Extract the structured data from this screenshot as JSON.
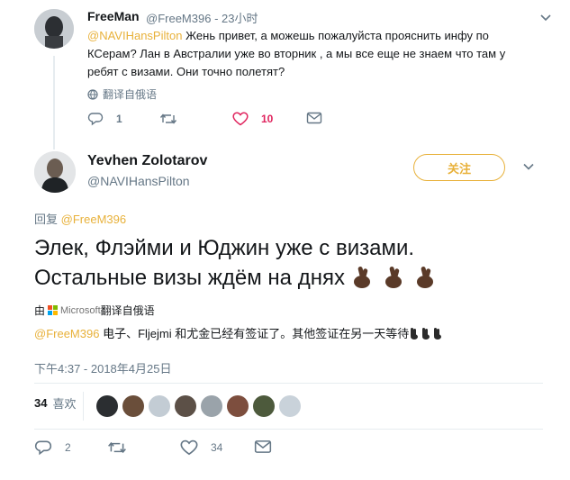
{
  "parent_tweet": {
    "author_name": "FreeMan",
    "author_handle": "@FreeM396",
    "time": "23小时",
    "mention": "@NAVIHansPilton",
    "text": " Жень привет, а можешь пожалуйста прояснить инфу по КСерам? Лан в Австралии уже во вторник , а мы все еще не знаем что там у ребят с визами. Они точно полетят?",
    "translate_label": "翻译自俄语",
    "reply_count": "1",
    "retweet_count": "",
    "like_count": "10"
  },
  "main_tweet": {
    "author_name": "Yevhen Zolotarov",
    "author_handle": "@NAVIHansPilton",
    "follow_label": "关注",
    "replying_label": "回复",
    "replying_to": "@FreeM396",
    "text_line1": "Элек, Флэйми и Юджин уже с визами.",
    "text_line2": "Остальные визы ждём на днях",
    "translated_by_prefix": "由",
    "translated_by_brand": "Microsoft",
    "translated_by_suffix": "翻译自俄语",
    "translated_mention": "@FreeM396",
    "translated_text": " 电子、Fljejmi 和尤金已经有签证了。其他签证在另一天等待",
    "timestamp": "下午4:37 - 2018年4月25日",
    "likes_count": "34",
    "likes_label": "喜欢",
    "reply_count": "2",
    "retweet_count": "",
    "like_count": "34"
  },
  "icons": {
    "reply": "reply-icon",
    "retweet": "retweet-icon",
    "like": "heart-icon",
    "dm": "envelope-icon",
    "globe": "globe-icon",
    "caret": "chevron-down-icon",
    "fingers_crossed": "fingers-crossed-emoji"
  },
  "colors": {
    "accent": "#e8b13a",
    "like_red": "#e0245e",
    "secondary_text": "#657786",
    "divider": "#e6ecf0"
  }
}
